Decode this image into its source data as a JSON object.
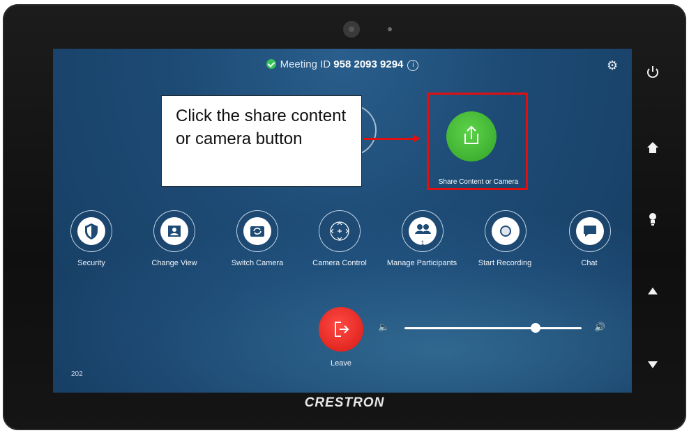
{
  "meeting": {
    "label": "Meeting ID",
    "id": "958 2093 9294",
    "info_glyph": "i"
  },
  "share_button": {
    "label": "Share Content or Camera"
  },
  "controls": [
    {
      "label": "Security"
    },
    {
      "label": "Change View"
    },
    {
      "label": "Switch Camera"
    },
    {
      "label": "Camera Control"
    },
    {
      "label": "Manage Participants",
      "badge": "1"
    },
    {
      "label": "Start Recording"
    },
    {
      "label": "Chat"
    }
  ],
  "leave": {
    "label": "Leave"
  },
  "volume": {
    "level": 0.74
  },
  "room": {
    "number": "202"
  },
  "brand": {
    "name": "CRESTRON"
  },
  "callout": {
    "text": "Click the share content or camera button"
  },
  "colors": {
    "share_green": "#3fb232",
    "leave_red": "#e1251f",
    "highlight_red": "#e01010",
    "screen_blue": "#1d4b75"
  }
}
